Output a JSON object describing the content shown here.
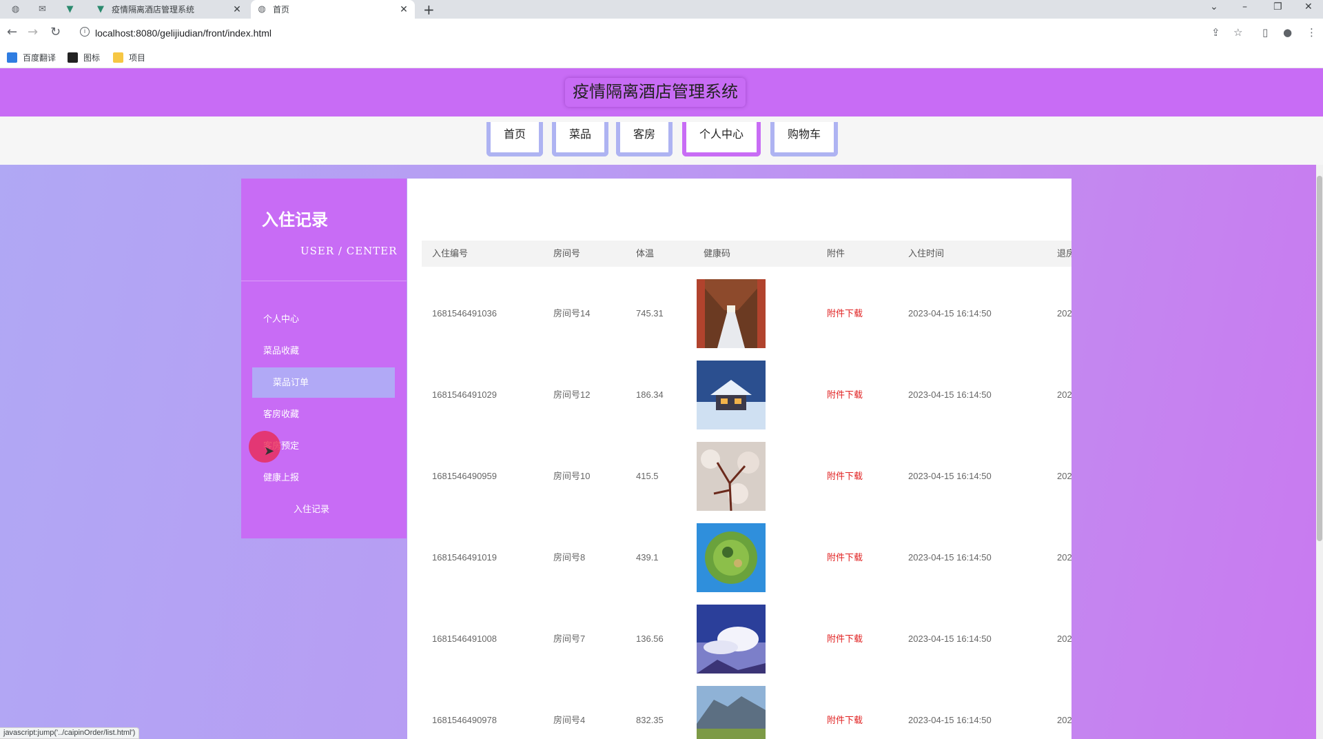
{
  "browser": {
    "tabs": [
      {
        "title": "疫情隔离酒店管理系统",
        "favicon": "v-logo-icon"
      },
      {
        "title": "首页",
        "favicon": "globe-icon"
      }
    ],
    "url": "localhost:8080/gelijiudian/front/index.html",
    "bookmarks": [
      "百度翻译",
      "图标",
      "项目"
    ],
    "status_text": "javascript:jump('../caipinOrder/list.html')"
  },
  "site": {
    "title": "疫情隔离酒店管理系统",
    "nav": [
      "首页",
      "菜品",
      "客房",
      "个人中心",
      "购物车"
    ],
    "active_nav": "个人中心"
  },
  "sidebar": {
    "title": "入住记录",
    "subtitle": "USER / CENTER",
    "items": [
      "个人中心",
      "菜品收藏",
      "菜品订单",
      "客房收藏",
      "客房预定",
      "健康上报",
      "入住记录"
    ],
    "hovered_item": "菜品订单"
  },
  "table": {
    "columns": [
      "入住编号",
      "房间号",
      "体温",
      "健康码",
      "附件",
      "入住时间",
      "退房"
    ],
    "rows": [
      {
        "id": "1681546491036",
        "room": "房间号14",
        "temp": "745.31",
        "attachment": "附件下载",
        "checkin": "2023-04-15 16:14:50",
        "checkout": "202"
      },
      {
        "id": "1681546491029",
        "room": "房间号12",
        "temp": "186.34",
        "attachment": "附件下载",
        "checkin": "2023-04-15 16:14:50",
        "checkout": "202"
      },
      {
        "id": "1681546490959",
        "room": "房间号10",
        "temp": "415.5",
        "attachment": "附件下载",
        "checkin": "2023-04-15 16:14:50",
        "checkout": "202"
      },
      {
        "id": "1681546491019",
        "room": "房间号8",
        "temp": "439.1",
        "attachment": "附件下载",
        "checkin": "2023-04-15 16:14:50",
        "checkout": "202"
      },
      {
        "id": "1681546491008",
        "room": "房间号7",
        "temp": "136.56",
        "attachment": "附件下载",
        "checkin": "2023-04-15 16:14:50",
        "checkout": "202"
      },
      {
        "id": "1681546490978",
        "room": "房间号4",
        "temp": "832.35",
        "attachment": "附件下载",
        "checkin": "2023-04-15 16:14:50",
        "checkout": "202"
      }
    ]
  },
  "colors": {
    "header": "#c86cf5",
    "nav_border": "#aeb3f2",
    "link": "#e02020",
    "sidebar_hover": "#b1a9f6"
  }
}
